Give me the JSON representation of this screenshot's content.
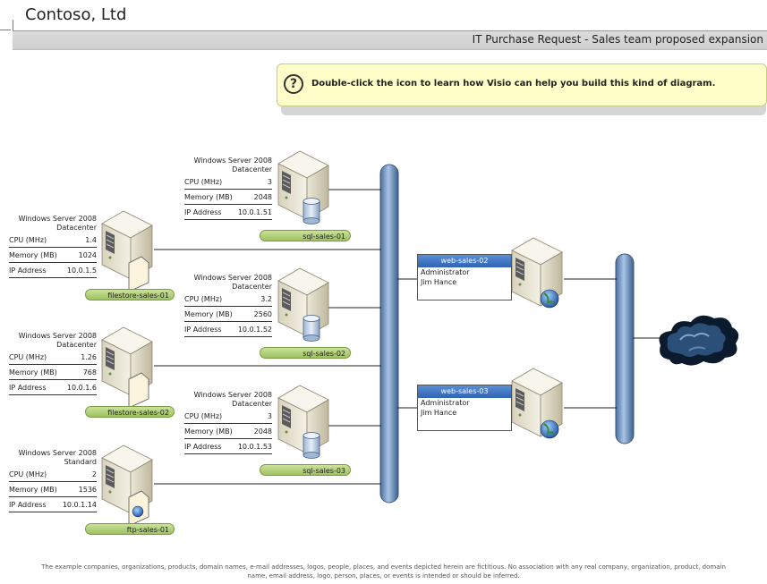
{
  "company": "Contoso, Ltd",
  "title": "IT Purchase Request - Sales team proposed expansion",
  "tip": {
    "icon": "question-icon",
    "text": "Double-click the icon to learn how Visio can help you build this kind of diagram."
  },
  "servers": [
    {
      "id": "filestore-sales-01",
      "os1": "Windows Server 2008",
      "os2": "Datacenter",
      "cpu_label": "CPU (MHz)",
      "cpu": "1.4",
      "mem_label": "Memory (MB)",
      "mem": "1024",
      "ip_label": "IP Address",
      "ip": "10.0.1.5",
      "icon": "file-server-icon"
    },
    {
      "id": "filestore-sales-02",
      "os1": "Windows Server 2008",
      "os2": "Datacenter",
      "cpu_label": "CPU (MHz)",
      "cpu": "1.26",
      "mem_label": "Memory (MB)",
      "mem": "768",
      "ip_label": "IP Address",
      "ip": "10.0.1.6",
      "icon": "file-server-icon"
    },
    {
      "id": "ftp-sales-01",
      "os1": "Windows Server 2008",
      "os2": "Standard",
      "cpu_label": "CPU (MHz)",
      "cpu": "2",
      "mem_label": "Memory (MB)",
      "mem": "1536",
      "ip_label": "IP Address",
      "ip": "10.0.1.14",
      "icon": "ftp-server-icon"
    },
    {
      "id": "sql-sales-01",
      "os1": "Windows Server 2008",
      "os2": "Datacenter",
      "cpu_label": "CPU (MHz)",
      "cpu": "3",
      "mem_label": "Memory (MB)",
      "mem": "2048",
      "ip_label": "IP Address",
      "ip": "10.0.1.51",
      "icon": "database-server-icon"
    },
    {
      "id": "sql-sales-02",
      "os1": "Windows Server 2008",
      "os2": "Datacenter",
      "cpu_label": "CPU (MHz)",
      "cpu": "3.2",
      "mem_label": "Memory (MB)",
      "mem": "2560",
      "ip_label": "IP Address",
      "ip": "10.0.1.52",
      "icon": "database-server-icon"
    },
    {
      "id": "sql-sales-03",
      "os1": "Windows Server 2008",
      "os2": "Datacenter",
      "cpu_label": "CPU (MHz)",
      "cpu": "3",
      "mem_label": "Memory (MB)",
      "mem": "2048",
      "ip_label": "IP Address",
      "ip": "10.0.1.53",
      "icon": "database-server-icon"
    }
  ],
  "web_servers": [
    {
      "name": "web-sales-02",
      "line1": "Administrator",
      "line2": "Jim Hance",
      "icon": "web-server-icon"
    },
    {
      "name": "web-sales-03",
      "line1": "Administrator",
      "line2": "Jim Hance",
      "icon": "web-server-icon"
    }
  ],
  "cloud_icon": "internet-cloud-icon",
  "disclaimer_1": "The example companies, organizations, products, domain names, e-mail addresses, logos, people, places, and events depicted herein are fictitious. No association with any real company, organization, product, domain",
  "disclaimer_2": "name, email address, logo, person, places, or events is intended or should be inferred."
}
